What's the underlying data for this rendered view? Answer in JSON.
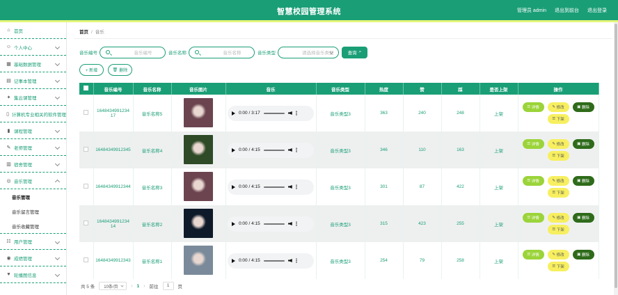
{
  "header": {
    "title": "智慧校园管理系统",
    "user": "管理员 admin",
    "back_front": "退出到前台",
    "logout": "退出登录"
  },
  "sidebar": {
    "items": [
      {
        "label": "首页",
        "icon": "home-icon"
      },
      {
        "label": "个人中心",
        "icon": "user-icon"
      },
      {
        "label": "基础数据管理",
        "icon": "grid-icon"
      },
      {
        "label": "记事本管理",
        "icon": "notebook-icon"
      },
      {
        "label": "集云课管理",
        "icon": "cloud-icon"
      },
      {
        "label": "计算机专业相关的软件管理",
        "icon": "computer-icon"
      },
      {
        "label": "课程管理",
        "icon": "book-icon"
      },
      {
        "label": "老师管理",
        "icon": "teacher-icon"
      },
      {
        "label": "宿舍管理",
        "icon": "building-icon"
      },
      {
        "label": "音乐管理",
        "icon": "music-icon"
      },
      {
        "label": "用户管理",
        "icon": "users-icon"
      },
      {
        "label": "成绩管理",
        "icon": "score-icon"
      },
      {
        "label": "轮播图信息",
        "icon": "image-icon"
      }
    ],
    "submenu": [
      "音乐管理",
      "音乐留言管理",
      "音乐收藏管理"
    ]
  },
  "breadcrumb": {
    "home": "首页",
    "sep": "/",
    "current": "音乐"
  },
  "search": {
    "code_label": "音乐编号",
    "code_placeholder": "音乐编号",
    "name_label": "音乐名称",
    "name_placeholder": "音乐名称",
    "type_label": "音乐类型",
    "type_placeholder": "请选择音乐类型",
    "query_label": "查询"
  },
  "actions": {
    "add": "+ 新增",
    "delete": "删除"
  },
  "table": {
    "headers": [
      "音乐编号",
      "音乐名称",
      "音乐图片",
      "音乐",
      "音乐类型",
      "热度",
      "赞",
      "踩",
      "是否上架",
      "操作"
    ],
    "rows": [
      {
        "code": "1648434991234 17",
        "name": "音乐名称5",
        "time": "0:00 / 3:17",
        "type": "音乐类型3",
        "heat": "363",
        "like": "240",
        "dislike": "248",
        "status": "上架",
        "img": "#6b4450"
      },
      {
        "code": "16484349912345",
        "name": "音乐名称4",
        "time": "0:00 / 4:15",
        "type": "音乐类型3",
        "heat": "346",
        "like": "110",
        "dislike": "163",
        "status": "上架",
        "img": "#2f4a26"
      },
      {
        "code": "16484349912344",
        "name": "音乐名称3",
        "time": "0:00 / 4:15",
        "type": "音乐类型3",
        "heat": "301",
        "like": "87",
        "dislike": "422",
        "status": "上架",
        "img": "#6b4450"
      },
      {
        "code": "1648434991234 14",
        "name": "音乐名称2",
        "time": "0:00 / 4:15",
        "type": "音乐类型3",
        "heat": "315",
        "like": "423",
        "dislike": "255",
        "status": "上架",
        "img": "#0e1a2a"
      },
      {
        "code": "16484349912343",
        "name": "音乐名称1",
        "time": "0:00 / 4:15",
        "type": "音乐类型3",
        "heat": "254",
        "like": "79",
        "dislike": "258",
        "status": "上架",
        "img": "#7a8a9a"
      }
    ],
    "op_labels": {
      "detail": "详情",
      "edit": "修改",
      "delete": "删除",
      "down": "下架"
    }
  },
  "pager": {
    "total": "共 5 条",
    "page_size": "10条/页",
    "prev": "‹",
    "page": "1",
    "next": "›",
    "goto_label": "前往",
    "goto_value": "1",
    "page_unit": "页"
  }
}
